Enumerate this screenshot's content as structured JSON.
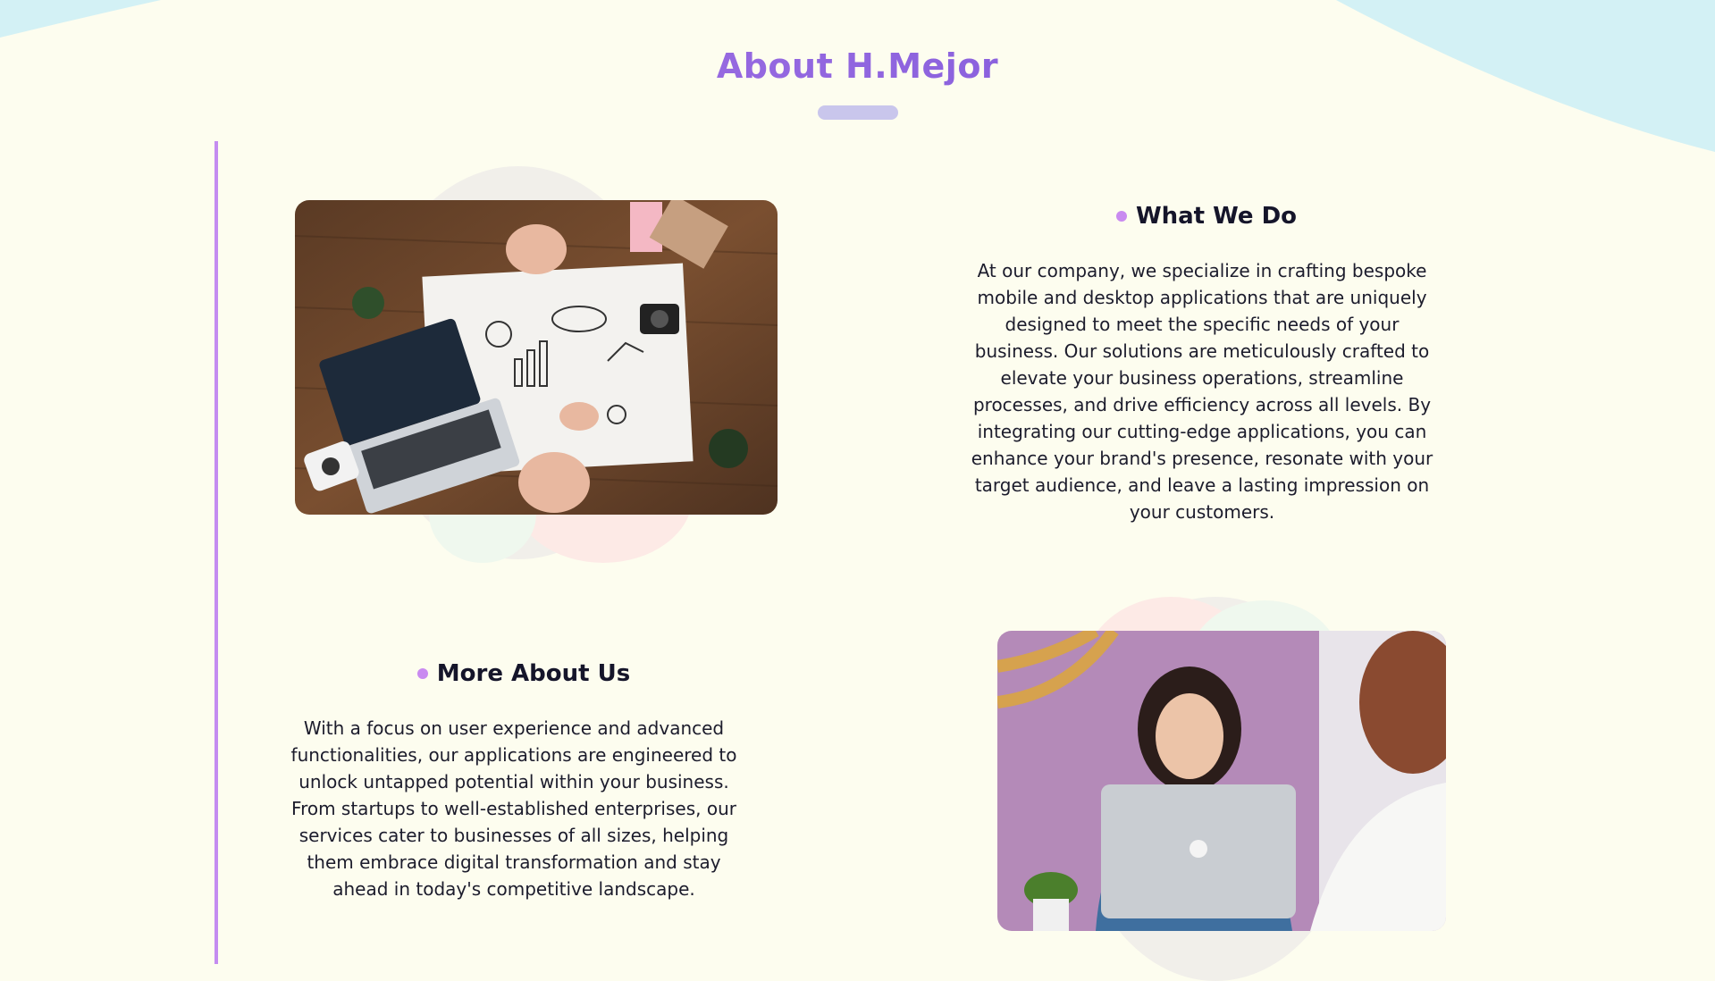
{
  "page_title": "About H.Mejor",
  "sections": [
    {
      "heading": "What We Do",
      "body": "At our company, we specialize in crafting bespoke mobile and desktop applications that are uniquely designed to meet the specific needs of your business. Our solutions are meticulously crafted to elevate your business operations, streamline processes, and drive efficiency across all levels. By integrating our cutting-edge applications, you can enhance your brand's presence, resonate with your target audience, and leave a lasting impression on your customers.",
      "image": "business-planning-desk-photo"
    },
    {
      "heading": "More About Us",
      "body": "With a focus on user experience and advanced functionalities, our applications are engineered to unlock untapped potential within your business. From startups to well-established enterprises, our services cater to businesses of all sizes, helping them embrace digital transformation and stay ahead in today's competitive landscape.",
      "image": "woman-with-laptop-photo"
    }
  ],
  "colors": {
    "background": "#fdfdef",
    "title_gradient_start": "#b27ce6",
    "title_gradient_end": "#6f4fd8",
    "accent_purple": "#c98af0",
    "timeline": "#c48cf0",
    "wave_blue": "#d3f1f5",
    "underline": "#c9c6ec"
  }
}
